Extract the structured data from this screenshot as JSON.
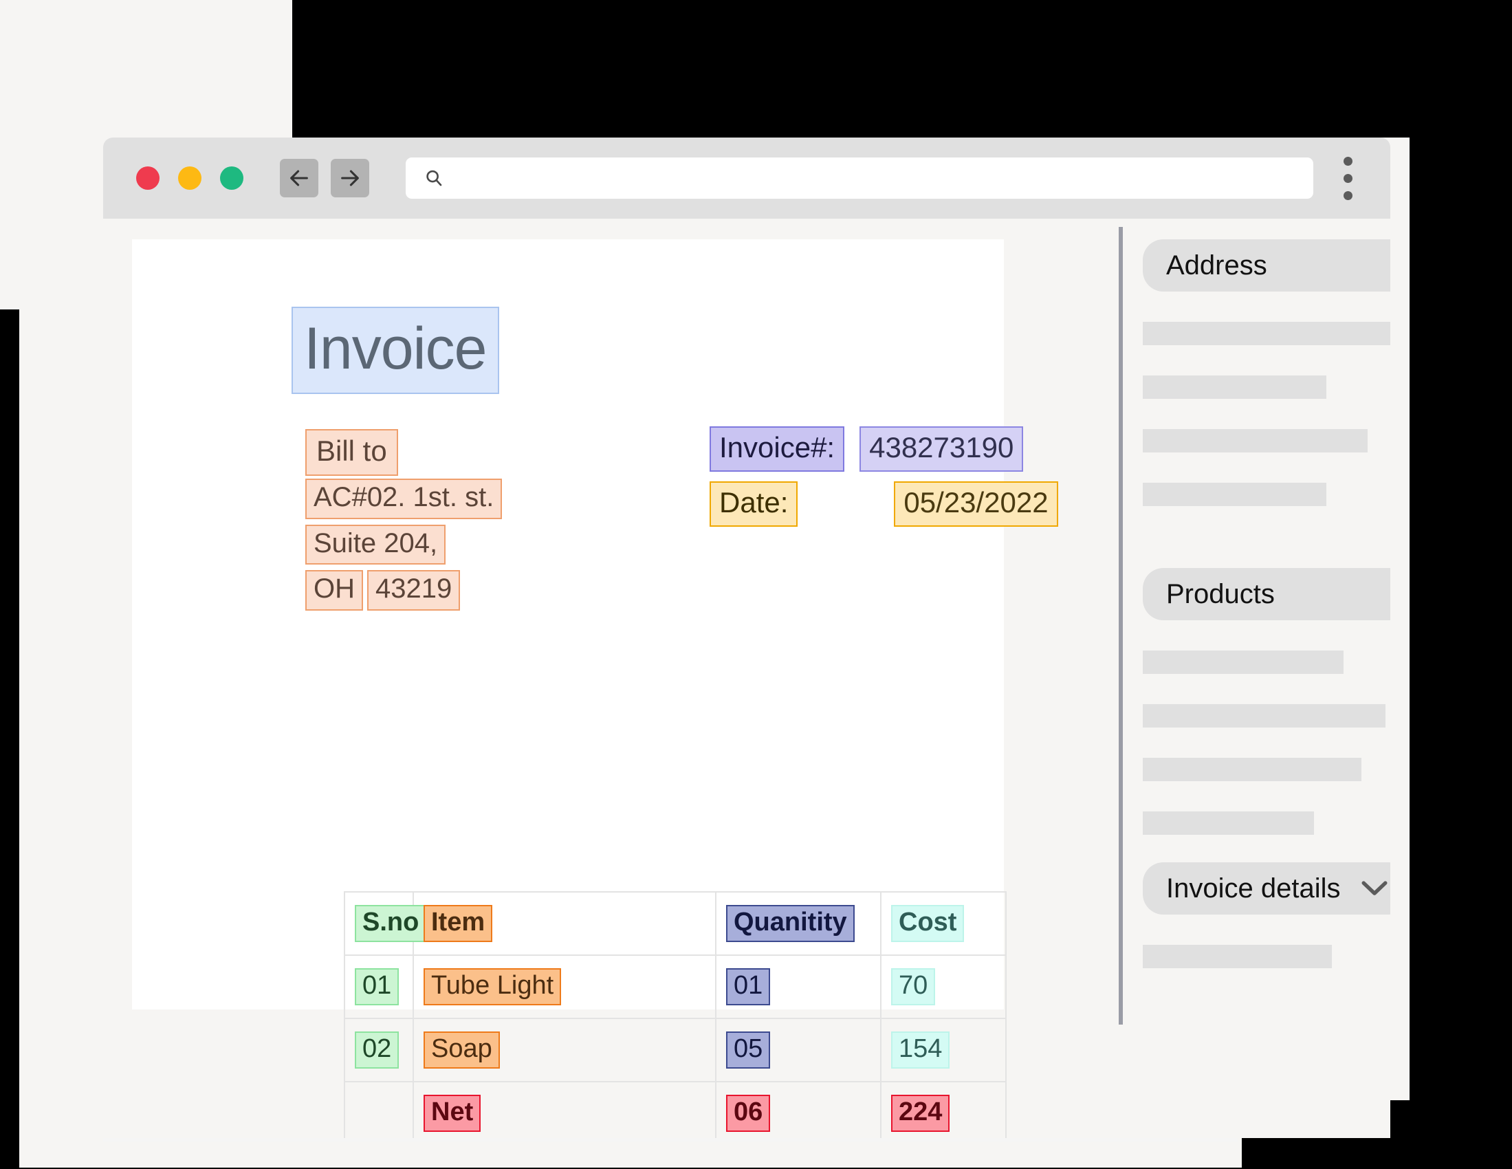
{
  "browser": {
    "window_controls": [
      "close",
      "minimize",
      "maximize"
    ],
    "back_label": "back-arrow",
    "forward_label": "forward-arrow",
    "search_icon": "search-icon",
    "url_value": "",
    "url_placeholder": "",
    "menu_icon": "kebab-menu-icon"
  },
  "document": {
    "title": "Invoice",
    "bill_to_label": "Bill to",
    "address_lines": [
      "AC#02. 1st. st.",
      "Suite 204,"
    ],
    "address_state": "OH",
    "address_zip": "43219",
    "invoice_number_label": "Invoice#:",
    "invoice_number_value": "438273190",
    "date_label": "Date:",
    "date_value": "05/23/2022"
  },
  "table": {
    "headers": [
      "S.no",
      "Item",
      "Quanitity",
      "Cost"
    ],
    "rows": [
      {
        "sno": "01",
        "item": "Tube Light",
        "qty": "01",
        "cost": "70"
      },
      {
        "sno": "02",
        "item": "Soap",
        "qty": "05",
        "cost": "154"
      }
    ],
    "total_row": {
      "sno": "",
      "item": "Net",
      "qty": "06",
      "cost": "224"
    }
  },
  "sidebar": {
    "sections": [
      {
        "label": "Address",
        "chevron": "chevron-down-icon",
        "skeleton_widths": [
          86,
          62,
          76,
          62
        ]
      },
      {
        "label": "Products",
        "chevron": "chevron-down-icon",
        "skeleton_widths": [
          68,
          82,
          74,
          58
        ]
      },
      {
        "label": "Invoice details",
        "chevron": "chevron-down-icon",
        "skeleton_widths": [
          64
        ]
      }
    ]
  },
  "colors": {
    "page_background": "#000000",
    "window_chrome": "#e0e0e0",
    "canvas": "#f6f5f3",
    "paper": "#ffffff",
    "divider": "#9a9ca6",
    "title_highlight": "#dbe7fb",
    "billto_highlight": "#fbdfd0",
    "invoice_num_highlight": "#c9c4f2",
    "date_highlight": "#fde8b8",
    "sno_highlight": "#ccf5d3",
    "item_highlight": "#fbc08a",
    "qty_highlight": "#a7aeda",
    "cost_highlight": "#d4fbf4",
    "net_highlight": "#fb9aa4",
    "skeleton": "#e0e0e0"
  }
}
